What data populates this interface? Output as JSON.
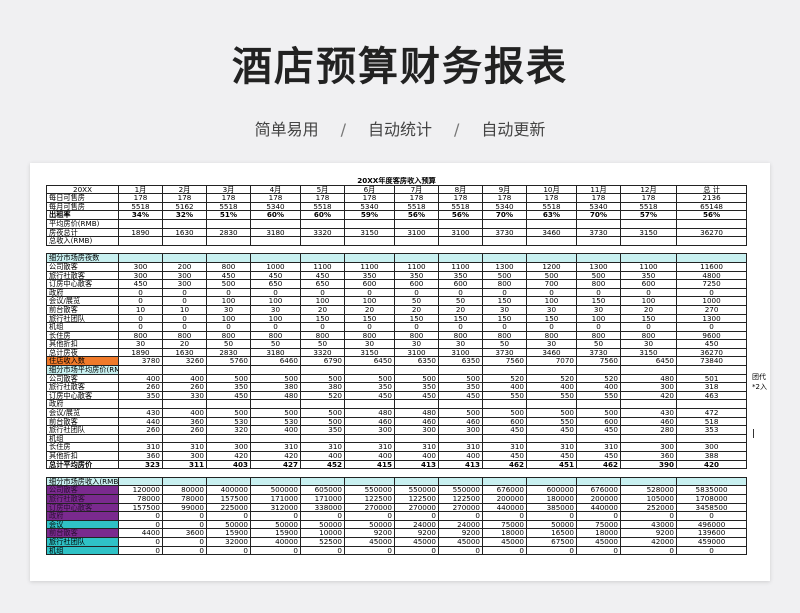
{
  "header": {
    "title": "酒店预算财务报表",
    "subtitle_items": [
      "简单易用",
      "自动统计",
      "自动更新"
    ],
    "separator": "/"
  },
  "sheet": {
    "table_title": "20XX年度客房收入预算",
    "header_row": [
      "20XX",
      "1月",
      "2月",
      "3月",
      "4月",
      "5月",
      "6月",
      "7月",
      "8月",
      "9月",
      "10月",
      "11月",
      "12月",
      "总 计"
    ],
    "rows": [
      {
        "label": "每日可售房",
        "cells": [
          "178",
          "178",
          "178",
          "178",
          "178",
          "178",
          "178",
          "178",
          "178",
          "178",
          "178",
          "178",
          "2136"
        ]
      },
      {
        "label": "每月可售房",
        "cells": [
          "5518",
          "5162",
          "5518",
          "5340",
          "5518",
          "5340",
          "5518",
          "5518",
          "5340",
          "5518",
          "5340",
          "5518",
          "65148"
        ]
      },
      {
        "label": "出租率",
        "style": "bold",
        "cells": [
          "34%",
          "32%",
          "51%",
          "60%",
          "60%",
          "59%",
          "56%",
          "56%",
          "70%",
          "63%",
          "70%",
          "57%",
          "56%"
        ]
      },
      {
        "label": "平均房价(RMB)",
        "cells": [
          "",
          "",
          "",
          "",
          "",
          "",
          "",
          "",
          "",
          "",
          "",
          "",
          ""
        ]
      },
      {
        "label": "房夜总计",
        "cells": [
          "1890",
          "1630",
          "2830",
          "3180",
          "3320",
          "3150",
          "3100",
          "3100",
          "3730",
          "3460",
          "3730",
          "3150",
          "36270"
        ]
      },
      {
        "label": "总收入(RMB)",
        "cells": [
          "",
          "",
          "",
          "",
          "",
          "",
          "",
          "",
          "",
          "",
          "",
          "",
          ""
        ]
      },
      {
        "label": "",
        "style": "blank",
        "cells": [
          "",
          "",
          "",
          "",
          "",
          "",
          "",
          "",
          "",
          "",
          "",
          "",
          ""
        ]
      },
      {
        "label": "细分市场房夜数",
        "style": "cyanall",
        "cells": [
          "",
          "",
          "",
          "",
          "",
          "",
          "",
          "",
          "",
          "",
          "",
          "",
          ""
        ]
      },
      {
        "label": "公司散客",
        "cells": [
          "300",
          "200",
          "800",
          "1000",
          "1100",
          "1100",
          "1100",
          "1100",
          "1300",
          "1200",
          "1300",
          "1100",
          "11600"
        ]
      },
      {
        "label": "旅行社散客",
        "cells": [
          "300",
          "300",
          "450",
          "450",
          "450",
          "350",
          "350",
          "350",
          "500",
          "500",
          "500",
          "350",
          "4800"
        ]
      },
      {
        "label": "订房中心散客",
        "cells": [
          "450",
          "300",
          "500",
          "650",
          "650",
          "600",
          "600",
          "600",
          "800",
          "700",
          "800",
          "600",
          "7250"
        ]
      },
      {
        "label": "政府",
        "cells": [
          "0",
          "0",
          "0",
          "0",
          "0",
          "0",
          "0",
          "0",
          "0",
          "0",
          "0",
          "0",
          "0"
        ]
      },
      {
        "label": "会议/展览",
        "cells": [
          "0",
          "0",
          "100",
          "100",
          "100",
          "100",
          "50",
          "50",
          "150",
          "100",
          "150",
          "100",
          "1000"
        ]
      },
      {
        "label": "前台散客",
        "cells": [
          "10",
          "10",
          "30",
          "30",
          "20",
          "20",
          "20",
          "20",
          "30",
          "30",
          "30",
          "20",
          "270"
        ]
      },
      {
        "label": "旅行社团队",
        "cells": [
          "0",
          "0",
          "100",
          "100",
          "150",
          "150",
          "150",
          "150",
          "150",
          "150",
          "100",
          "150",
          "1300"
        ]
      },
      {
        "label": "机组",
        "cells": [
          "0",
          "0",
          "0",
          "0",
          "0",
          "0",
          "0",
          "0",
          "0",
          "0",
          "0",
          "0",
          "0"
        ]
      },
      {
        "label": "长住房",
        "cells": [
          "800",
          "800",
          "800",
          "800",
          "800",
          "800",
          "800",
          "800",
          "800",
          "800",
          "800",
          "800",
          "9600"
        ]
      },
      {
        "label": "其他折扣",
        "cells": [
          "30",
          "20",
          "50",
          "50",
          "50",
          "30",
          "30",
          "30",
          "50",
          "30",
          "50",
          "30",
          "450"
        ]
      },
      {
        "label": "总计房夜",
        "cells": [
          "1890",
          "1630",
          "2830",
          "3180",
          "3320",
          "3150",
          "3100",
          "3100",
          "3730",
          "3460",
          "3730",
          "3150",
          "36270"
        ]
      },
      {
        "label": "住店收入数",
        "style": "orange",
        "cells": [
          "3780",
          "3260",
          "5760",
          "6460",
          "6790",
          "6450",
          "6350",
          "6350",
          "7560",
          "7070",
          "7560",
          "6450",
          "73840"
        ]
      },
      {
        "label": "细分市场平均房价(RMB)",
        "style": "cyan",
        "cells": [
          "",
          "",
          "",
          "",
          "",
          "",
          "",
          "",
          "",
          "",
          "",
          "",
          ""
        ]
      },
      {
        "label": "公司散客",
        "cells": [
          "400",
          "400",
          "500",
          "500",
          "500",
          "500",
          "500",
          "500",
          "520",
          "520",
          "520",
          "480",
          "501"
        ]
      },
      {
        "label": "旅行社散客",
        "cells": [
          "260",
          "260",
          "350",
          "380",
          "380",
          "350",
          "350",
          "350",
          "400",
          "400",
          "400",
          "300",
          "318"
        ]
      },
      {
        "label": "订房中心散客",
        "cells": [
          "350",
          "330",
          "450",
          "480",
          "520",
          "450",
          "450",
          "450",
          "550",
          "550",
          "550",
          "420",
          "463"
        ]
      },
      {
        "label": "政府",
        "cells": [
          "",
          "",
          "",
          "",
          "",
          "",
          "",
          "",
          "",
          "",
          "",
          "",
          ""
        ]
      },
      {
        "label": "会议/展览",
        "cells": [
          "430",
          "400",
          "500",
          "500",
          "500",
          "480",
          "480",
          "500",
          "500",
          "500",
          "500",
          "430",
          "472"
        ]
      },
      {
        "label": "前台散客",
        "cells": [
          "440",
          "360",
          "530",
          "530",
          "500",
          "460",
          "460",
          "460",
          "600",
          "550",
          "600",
          "460",
          "518"
        ]
      },
      {
        "label": "旅行社团队",
        "cells": [
          "260",
          "260",
          "320",
          "400",
          "350",
          "300",
          "300",
          "300",
          "450",
          "450",
          "450",
          "280",
          "353"
        ]
      },
      {
        "label": "机组",
        "cells": [
          "",
          "",
          "",
          "",
          "",
          "",
          "",
          "",
          "",
          "",
          "",
          "",
          ""
        ]
      },
      {
        "label": "长住房",
        "cells": [
          "310",
          "310",
          "300",
          "310",
          "310",
          "310",
          "310",
          "310",
          "310",
          "310",
          "310",
          "300",
          "300"
        ]
      },
      {
        "label": "其他折扣",
        "cells": [
          "360",
          "300",
          "420",
          "420",
          "400",
          "400",
          "400",
          "400",
          "450",
          "450",
          "450",
          "360",
          "388"
        ]
      },
      {
        "label": "总计平均房价",
        "style": "bold",
        "cells": [
          "323",
          "311",
          "403",
          "427",
          "452",
          "415",
          "413",
          "413",
          "462",
          "451",
          "462",
          "390",
          "420"
        ]
      },
      {
        "label": "",
        "style": "blank",
        "cells": [
          "",
          "",
          "",
          "",
          "",
          "",
          "",
          "",
          "",
          "",
          "",
          "",
          ""
        ]
      },
      {
        "label": "细分市场房收入(RMB)",
        "style": "cyanall",
        "cells": [
          "",
          "",
          "",
          "",
          "",
          "",
          "",
          "",
          "",
          "",
          "",
          "",
          ""
        ]
      },
      {
        "label": "公司散客",
        "style": "purple",
        "cells": [
          "120000",
          "80000",
          "400000",
          "500000",
          "605000",
          "550000",
          "550000",
          "550000",
          "676000",
          "600000",
          "676000",
          "528000",
          "5835000"
        ]
      },
      {
        "label": "旅行社散客",
        "style": "purple",
        "cells": [
          "78000",
          "78000",
          "157500",
          "171000",
          "171000",
          "122500",
          "122500",
          "122500",
          "200000",
          "180000",
          "200000",
          "105000",
          "1708000"
        ]
      },
      {
        "label": "订房中心散客",
        "style": "purple",
        "cells": [
          "157500",
          "99000",
          "225000",
          "312000",
          "338000",
          "270000",
          "270000",
          "270000",
          "440000",
          "385000",
          "440000",
          "252000",
          "3458500"
        ]
      },
      {
        "label": "政府",
        "style": "purple",
        "cells": [
          "0",
          "0",
          "0",
          "0",
          "0",
          "0",
          "0",
          "0",
          "0",
          "0",
          "0",
          "0",
          "0"
        ]
      },
      {
        "label": "会议",
        "style": "teal",
        "cells": [
          "0",
          "0",
          "50000",
          "50000",
          "50000",
          "50000",
          "24000",
          "24000",
          "75000",
          "50000",
          "75000",
          "43000",
          "496000"
        ]
      },
      {
        "label": "前台散客",
        "style": "purple",
        "cells": [
          "4400",
          "3600",
          "15900",
          "15900",
          "10000",
          "9200",
          "9200",
          "9200",
          "18000",
          "16500",
          "18000",
          "9200",
          "139600"
        ]
      },
      {
        "label": "旅行社团队",
        "style": "teal",
        "cells": [
          "0",
          "0",
          "32000",
          "40000",
          "52500",
          "45000",
          "45000",
          "45000",
          "45000",
          "67500",
          "45000",
          "42000",
          "459000"
        ]
      },
      {
        "label": "机组",
        "style": "teal",
        "cells": [
          "0",
          "0",
          "0",
          "0",
          "0",
          "0",
          "0",
          "0",
          "0",
          "0",
          "0",
          "0",
          "0"
        ]
      }
    ],
    "side_note": "团代*2入"
  }
}
